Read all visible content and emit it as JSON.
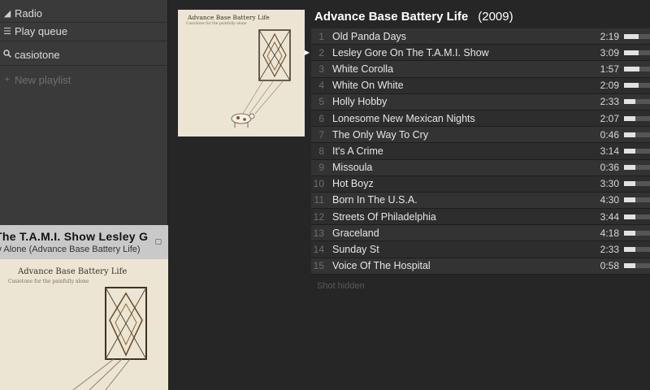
{
  "sidebar": {
    "items": [
      {
        "label": "Radio",
        "icon": "radio-icon"
      },
      {
        "label": "Play queue",
        "icon": "queue-icon"
      },
      {
        "label": "casiotone",
        "icon": "search-icon"
      },
      {
        "label": "New playlist",
        "icon": "plus-icon"
      }
    ]
  },
  "now_playing": {
    "title_scroll": "The T.A.M.I. Show     Lesley G",
    "subtitle": "ly Alone (Advance Base Battery Life)"
  },
  "album": {
    "title": "Advance Base Battery Life",
    "year": "(2009)",
    "cover_title": "Advance Base Battery Life",
    "cover_subtitle": "Casiotone for the painfully alone"
  },
  "tracks": [
    {
      "num": "1",
      "name": "Old Panda Days",
      "duration": "2:19",
      "popularity": 0.55,
      "playing": false
    },
    {
      "num": "2",
      "name": "Lesley Gore On The T.A.M.I. Show",
      "duration": "3:09",
      "popularity": 0.55,
      "playing": true
    },
    {
      "num": "3",
      "name": "White Corolla",
      "duration": "1:57",
      "popularity": 0.6,
      "playing": false
    },
    {
      "num": "4",
      "name": "White On White",
      "duration": "2:09",
      "popularity": 0.55,
      "playing": false
    },
    {
      "num": "5",
      "name": "Holly Hobby",
      "duration": "2:33",
      "popularity": 0.45,
      "playing": false
    },
    {
      "num": "6",
      "name": "Lonesome New Mexican Nights",
      "duration": "2:07",
      "popularity": 0.45,
      "playing": false
    },
    {
      "num": "7",
      "name": "The Only Way To Cry",
      "duration": "0:46",
      "popularity": 0.45,
      "playing": false
    },
    {
      "num": "8",
      "name": "It's A Crime",
      "duration": "3:14",
      "popularity": 0.45,
      "playing": false
    },
    {
      "num": "9",
      "name": "Missoula",
      "duration": "0:36",
      "popularity": 0.45,
      "playing": false
    },
    {
      "num": "10",
      "name": "Hot Boyz",
      "duration": "3:30",
      "popularity": 0.45,
      "playing": false
    },
    {
      "num": "11",
      "name": "Born In The U.S.A.",
      "duration": "4:30",
      "popularity": 0.45,
      "playing": false
    },
    {
      "num": "12",
      "name": "Streets Of Philadelphia",
      "duration": "3:44",
      "popularity": 0.45,
      "playing": false
    },
    {
      "num": "13",
      "name": "Graceland",
      "duration": "4:18",
      "popularity": 0.45,
      "playing": false
    },
    {
      "num": "14",
      "name": "Sunday St",
      "duration": "2:33",
      "popularity": 0.45,
      "playing": false
    },
    {
      "num": "15",
      "name": "Voice Of The Hospital",
      "duration": "0:58",
      "popularity": 0.45,
      "playing": false
    }
  ],
  "show_more_label": "Shot hidden",
  "colors": {
    "background": "#262626",
    "sidebar": "#3a3a3a",
    "now_playing_bar": "#c9c9c9",
    "cover_paper": "#ece5d4"
  }
}
